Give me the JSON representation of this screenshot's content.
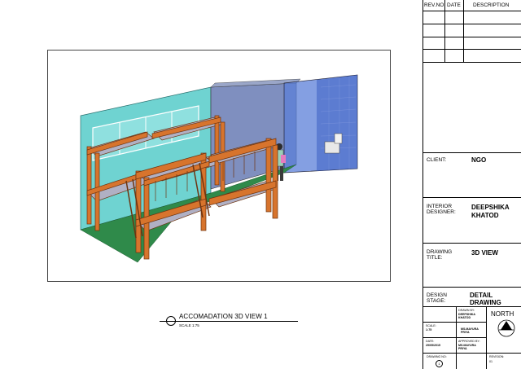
{
  "revision_table": {
    "headers": [
      "REV.NO",
      "DATE",
      "DESCRIPTION"
    ],
    "rows": 4
  },
  "drawing": {
    "caption": "ACCOMADATION 3D VIEW 1",
    "scale": "SCALE 1:75"
  },
  "title_block": {
    "client_label": "CLIENT:",
    "client_value": "NGO",
    "designer_label_1": "INTERIOR",
    "designer_label_2": "DESIGNER:",
    "designer_value_1": "DEEPSHIKA",
    "designer_value_2": "KHATOD",
    "drawing_title_label_1": "DRAWING",
    "drawing_title_label_2": "TITLE:",
    "drawing_title_value": "3D VIEW",
    "design_stage_label_1": "DESIGN",
    "design_stage_label_2": "STAGE:",
    "design_stage_value_1": "DETAIL",
    "design_stage_value_2": "DRAWING",
    "drawn_by_label": "DRAWN BY:",
    "drawn_by_value_1": "DEEPSHIKA",
    "drawn_by_value_2": "KHATOD",
    "north_label": "NORTH",
    "scale_label": "SCALE:",
    "scale_value": "1:75",
    "approved_by_label_1": "MS.MAYURA",
    "approved_by_label_2": "PRIYA",
    "date_label": "DATE:",
    "date_value": "29/05/2015",
    "approved_by_caption": "APPROVED BY:",
    "approved_by_value_1": "MS.MAYURA",
    "approved_by_value_2": "PRIYA",
    "drawing_no_label": "DRAWING NO:",
    "drawing_no_value": "1",
    "revision_label": "REVISION:",
    "revision_value": "01"
  },
  "colors": {
    "wall": "#6fd3d1",
    "bed_wood": "#d7742d",
    "mattress": "#b0b0c4",
    "floor": "#2f8a4a",
    "glass": "#5b7fd8"
  }
}
